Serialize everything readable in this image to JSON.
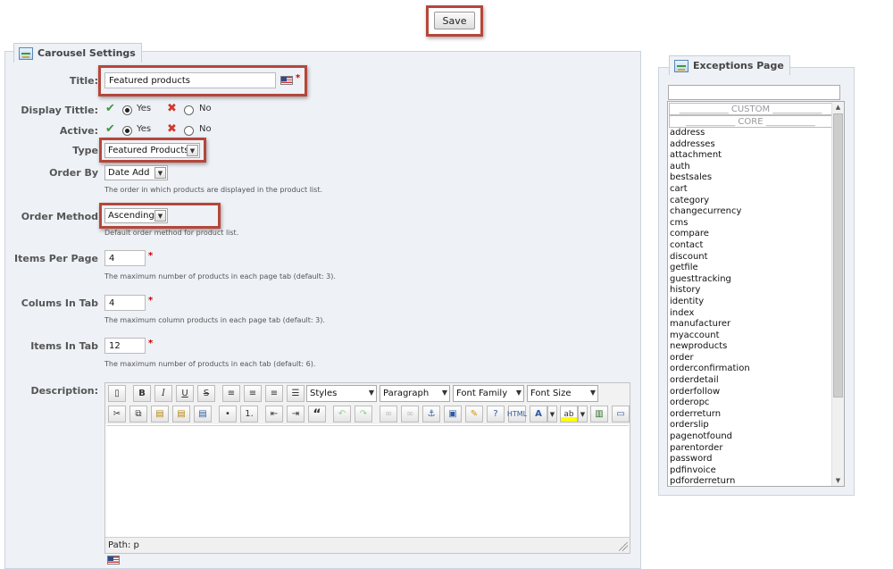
{
  "toolbar": {
    "save_label": "Save"
  },
  "carousel": {
    "legend": "Carousel Settings",
    "title": {
      "label": "Title:",
      "value": "Featured products"
    },
    "display_title": {
      "label": "Display Tittle:",
      "yes": "Yes",
      "no": "No"
    },
    "active": {
      "label": "Active:",
      "yes": "Yes",
      "no": "No"
    },
    "type": {
      "label": "Type",
      "value": "Featured Products"
    },
    "order_by": {
      "label": "Order By",
      "value": "Date Add",
      "help": "The order in which products are displayed in the product list."
    },
    "order_method": {
      "label": "Order Method",
      "value": "Ascending",
      "help": "Default order method for product list."
    },
    "items_per_page": {
      "label": "Items Per Page",
      "value": "4",
      "help": "The maximum number of products in each page tab (default: 3)."
    },
    "columns_in_tab": {
      "label": "Colums In Tab",
      "value": "4",
      "help": "The maximum column products in each page tab (default: 3)."
    },
    "items_in_tab": {
      "label": "Items In Tab",
      "value": "12",
      "help": "The maximum number of products in each tab (default: 6)."
    },
    "description": {
      "label": "Description:"
    },
    "required_mark": "*"
  },
  "editor": {
    "styles": "Styles",
    "format": "Paragraph",
    "font_family": "Font Family",
    "font_size": "Font Size",
    "path": "Path: p",
    "buttons": {
      "bold": "B",
      "italic": "I",
      "underline": "U",
      "strike": "S",
      "quote": "“",
      "new_doc": "new-document-icon",
      "align_left": "align-left-icon",
      "align_center": "align-center-icon",
      "align_right": "align-right-icon",
      "justify": "justify-icon",
      "cut": "cut-icon",
      "copy": "copy-icon",
      "paste": "paste-icon",
      "paste_text": "paste-text-icon",
      "paste_word": "paste-word-icon",
      "bullet_list": "bullet-list-icon",
      "number_list": "number-list-icon",
      "outdent": "outdent-icon",
      "indent": "indent-icon",
      "undo": "undo-icon",
      "redo": "redo-icon",
      "link": "link-icon",
      "unlink": "unlink-icon",
      "anchor": "anchor-icon",
      "image": "image-icon",
      "cleanup": "cleanup-icon",
      "help": "help-icon",
      "html": "html-icon",
      "text_color": "text-color-icon",
      "bg_color": "background-color-icon",
      "media": "media-icon",
      "visual_aid": "visual-aid-icon"
    }
  },
  "exceptions": {
    "legend": "Exceptions Page",
    "custom_header": "___________ CUSTOM ___________",
    "core_header": "___________ CORE ___________",
    "items": [
      "address",
      "addresses",
      "attachment",
      "auth",
      "bestsales",
      "cart",
      "category",
      "changecurrency",
      "cms",
      "compare",
      "contact",
      "discount",
      "getfile",
      "guesttracking",
      "history",
      "identity",
      "index",
      "manufacturer",
      "myaccount",
      "newproducts",
      "order",
      "orderconfirmation",
      "orderdetail",
      "orderfollow",
      "orderopc",
      "orderreturn",
      "orderslip",
      "pagenotfound",
      "parentorder",
      "password",
      "pdfinvoice",
      "pdforderreturn"
    ]
  },
  "colors": {
    "highlight": "#b5473a",
    "panel": "#eef1f6",
    "check": "#3d9a3d",
    "cross": "#d03a2c"
  }
}
